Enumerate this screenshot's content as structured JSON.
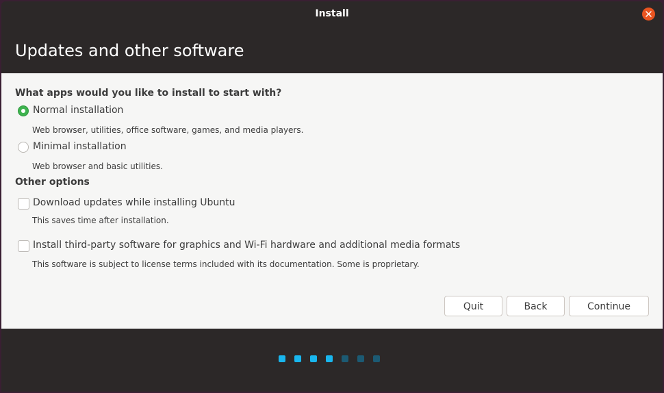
{
  "window": {
    "title": "Install"
  },
  "page": {
    "heading": "Updates and other software"
  },
  "install_type": {
    "question": "What apps would you like to install to start with?",
    "options": [
      {
        "label": "Normal installation",
        "description": "Web browser, utilities, office software, games, and media players.",
        "selected": true
      },
      {
        "label": "Minimal installation",
        "description": "Web browser and basic utilities.",
        "selected": false
      }
    ]
  },
  "other_options": {
    "title": "Other options",
    "items": [
      {
        "label": "Download updates while installing Ubuntu",
        "description": "This saves time after installation.",
        "checked": false
      },
      {
        "label": "Install third-party software for graphics and Wi-Fi hardware and additional media formats",
        "description": "This software is subject to license terms included with its documentation. Some is proprietary.",
        "checked": false
      }
    ]
  },
  "buttons": {
    "quit": "Quit",
    "back": "Back",
    "continue": "Continue"
  },
  "progress": {
    "total_steps": 7,
    "completed_steps": 4
  },
  "colors": {
    "accent_green": "#3eb34f",
    "close_orange": "#e95420",
    "dot_active": "#19b6ee",
    "dot_inactive": "#1c5a73"
  }
}
